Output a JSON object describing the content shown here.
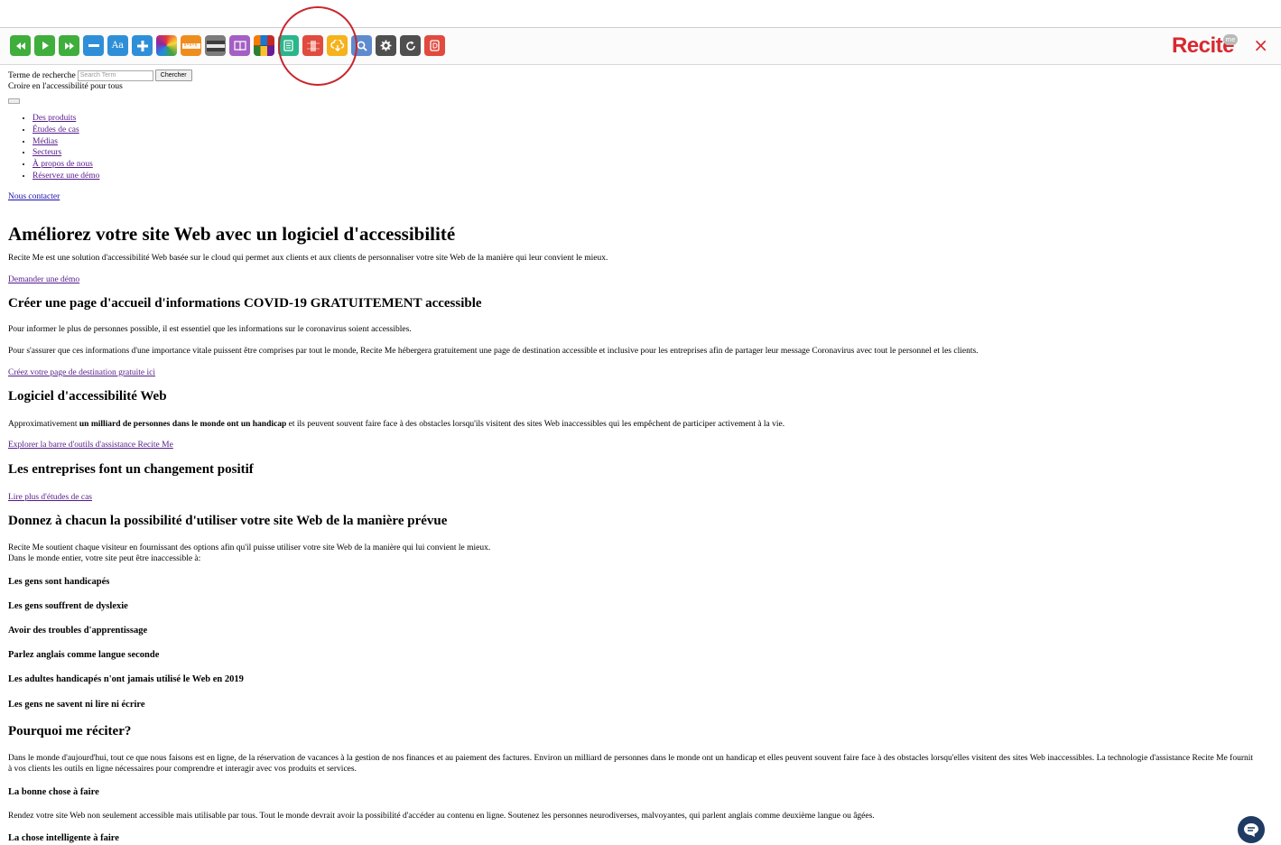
{
  "toolbar": {
    "buttons": [
      {
        "name": "rewind-icon",
        "color": "#3fae3c"
      },
      {
        "name": "play-icon",
        "color": "#3fae3c"
      },
      {
        "name": "fast-forward-icon",
        "color": "#3fae3c"
      },
      {
        "name": "decrease-text-icon",
        "color": "#2e8fd8"
      },
      {
        "name": "font-icon",
        "label": "Aa",
        "color": "#2e8fd8"
      },
      {
        "name": "increase-text-icon",
        "color": "#2e8fd8"
      },
      {
        "name": "color-wheel-icon"
      },
      {
        "name": "ruler-icon",
        "color": "#ee8d1f"
      },
      {
        "name": "screen-mask-icon",
        "color": "#7b7b7b"
      },
      {
        "name": "dictionary-icon",
        "color": "#a35fc4"
      },
      {
        "name": "mosaic-icon"
      },
      {
        "name": "text-only-icon",
        "color": "#2bb58a"
      },
      {
        "name": "magnifier-strip-icon",
        "color": "#e14a3e"
      },
      {
        "name": "cloud-download-icon",
        "color": "#f5b21c"
      },
      {
        "name": "search-icon",
        "color": "#5e8bcf"
      },
      {
        "name": "gear-icon",
        "color": "#4f4f4f"
      },
      {
        "name": "reset-icon",
        "color": "#4f4f4f"
      },
      {
        "name": "pdf-icon",
        "color": "#e14a3e"
      }
    ],
    "brand": "Recite",
    "brand_badge": "me",
    "close_glyph": "×",
    "accent_color": "#d9282f"
  },
  "search": {
    "label": "Terme de recherche",
    "placeholder": "Search Term",
    "button": "Chercher"
  },
  "tagline": "Croire en l'accessibilité pour tous",
  "nav": [
    "Des produits",
    "Études de cas",
    "Médias",
    "Secteurs",
    "À propos de nous",
    "Réservez une démo"
  ],
  "contact_link": "Nous contacter",
  "hero": {
    "title": "Améliorez votre site Web avec un logiciel d'accessibilité",
    "text": "Recite Me est une solution d'accessibilité Web basée sur le cloud qui permet aux clients et aux clients de personnaliser votre site Web de la manière qui leur convient le mieux.",
    "link": "Demander une démo"
  },
  "covid": {
    "title": "Créer une page d'accueil d'informations COVID-19 GRATUITEMENT accessible",
    "p1": "Pour informer le plus de personnes possible, il est essentiel que les informations sur le coronavirus soient accessibles.",
    "p2": "Pour s'assurer que ces informations d'une importance vitale puissent être comprises par tout le monde, Recite Me hébergera gratuitement une page de destination accessible et inclusive pour les entreprises afin de partager leur message Coronavirus avec tout le personnel et les clients.",
    "link": "Créez votre page de destination gratuite ici"
  },
  "software": {
    "title": "Logiciel d'accessibilité Web",
    "text_before": "Approximativement ",
    "text_bold": "un milliard de personnes dans le monde ont un handicap",
    "text_after": " et ils peuvent souvent faire face à des obstacles lorsqu'ils visitent des sites Web inaccessibles qui les empêchent de participer activement à la vie.",
    "link": "Explorer la barre d'outils d'assistance Recite Me"
  },
  "companies": {
    "title": "Les entreprises font un changement positif",
    "link": "Lire plus d'études de cas"
  },
  "everyone": {
    "title": "Donnez à chacun la possibilité d'utiliser votre site Web de la manière prévue",
    "line1": "Recite Me soutient chaque visiteur en fournissant des options afin qu'il puisse utiliser votre site Web de la manière qui lui convient le mieux.",
    "line2": "Dans le monde entier, votre site peut être inaccessible à:"
  },
  "groups": [
    "Les gens sont handicapés",
    "Les gens souffrent de dyslexie",
    "Avoir des troubles d'apprentissage",
    "Parlez anglais comme langue seconde",
    "Les adultes handicapés n'ont jamais utilisé le Web en 2019",
    "Les gens ne savent ni lire ni écrire"
  ],
  "why": {
    "title": "Pourquoi me réciter?",
    "text": "Dans le monde d'aujourd'hui, tout ce que nous faisons est en ligne, de la réservation de vacances à la gestion de nos finances et au paiement des factures. Environ un milliard de personnes dans le monde ont un handicap et elles peuvent souvent faire face à des obstacles lorsqu'elles visitent des sites Web inaccessibles. La technologie d'assistance Recite Me fournit à vos clients les outils en ligne nécessaires pour comprendre et interagir avec vos produits et services."
  },
  "right_thing": {
    "title": "La bonne chose à faire",
    "text": "Rendez votre site Web non seulement accessible mais utilisable par tous. Tout le monde devrait avoir la possibilité d'accéder au contenu en ligne. Soutenez les personnes neurodiverses, malvoyantes, qui parlent anglais comme deuxième langue ou âgées."
  },
  "smart_thing": {
    "title": "La chose intelligente à faire"
  },
  "chat": {
    "icon": "chat-icon",
    "color": "#1f3b63"
  }
}
